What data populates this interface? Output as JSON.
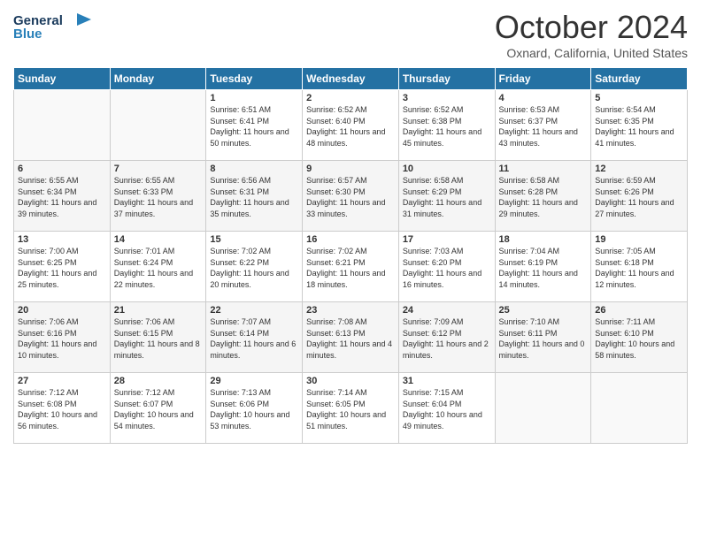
{
  "header": {
    "logo_line1": "General",
    "logo_line2": "Blue",
    "month": "October 2024",
    "location": "Oxnard, California, United States"
  },
  "days_of_week": [
    "Sunday",
    "Monday",
    "Tuesday",
    "Wednesday",
    "Thursday",
    "Friday",
    "Saturday"
  ],
  "weeks": [
    [
      {
        "day": "",
        "info": ""
      },
      {
        "day": "",
        "info": ""
      },
      {
        "day": "1",
        "info": "Sunrise: 6:51 AM\nSunset: 6:41 PM\nDaylight: 11 hours and 50 minutes."
      },
      {
        "day": "2",
        "info": "Sunrise: 6:52 AM\nSunset: 6:40 PM\nDaylight: 11 hours and 48 minutes."
      },
      {
        "day": "3",
        "info": "Sunrise: 6:52 AM\nSunset: 6:38 PM\nDaylight: 11 hours and 45 minutes."
      },
      {
        "day": "4",
        "info": "Sunrise: 6:53 AM\nSunset: 6:37 PM\nDaylight: 11 hours and 43 minutes."
      },
      {
        "day": "5",
        "info": "Sunrise: 6:54 AM\nSunset: 6:35 PM\nDaylight: 11 hours and 41 minutes."
      }
    ],
    [
      {
        "day": "6",
        "info": "Sunrise: 6:55 AM\nSunset: 6:34 PM\nDaylight: 11 hours and 39 minutes."
      },
      {
        "day": "7",
        "info": "Sunrise: 6:55 AM\nSunset: 6:33 PM\nDaylight: 11 hours and 37 minutes."
      },
      {
        "day": "8",
        "info": "Sunrise: 6:56 AM\nSunset: 6:31 PM\nDaylight: 11 hours and 35 minutes."
      },
      {
        "day": "9",
        "info": "Sunrise: 6:57 AM\nSunset: 6:30 PM\nDaylight: 11 hours and 33 minutes."
      },
      {
        "day": "10",
        "info": "Sunrise: 6:58 AM\nSunset: 6:29 PM\nDaylight: 11 hours and 31 minutes."
      },
      {
        "day": "11",
        "info": "Sunrise: 6:58 AM\nSunset: 6:28 PM\nDaylight: 11 hours and 29 minutes."
      },
      {
        "day": "12",
        "info": "Sunrise: 6:59 AM\nSunset: 6:26 PM\nDaylight: 11 hours and 27 minutes."
      }
    ],
    [
      {
        "day": "13",
        "info": "Sunrise: 7:00 AM\nSunset: 6:25 PM\nDaylight: 11 hours and 25 minutes."
      },
      {
        "day": "14",
        "info": "Sunrise: 7:01 AM\nSunset: 6:24 PM\nDaylight: 11 hours and 22 minutes."
      },
      {
        "day": "15",
        "info": "Sunrise: 7:02 AM\nSunset: 6:22 PM\nDaylight: 11 hours and 20 minutes."
      },
      {
        "day": "16",
        "info": "Sunrise: 7:02 AM\nSunset: 6:21 PM\nDaylight: 11 hours and 18 minutes."
      },
      {
        "day": "17",
        "info": "Sunrise: 7:03 AM\nSunset: 6:20 PM\nDaylight: 11 hours and 16 minutes."
      },
      {
        "day": "18",
        "info": "Sunrise: 7:04 AM\nSunset: 6:19 PM\nDaylight: 11 hours and 14 minutes."
      },
      {
        "day": "19",
        "info": "Sunrise: 7:05 AM\nSunset: 6:18 PM\nDaylight: 11 hours and 12 minutes."
      }
    ],
    [
      {
        "day": "20",
        "info": "Sunrise: 7:06 AM\nSunset: 6:16 PM\nDaylight: 11 hours and 10 minutes."
      },
      {
        "day": "21",
        "info": "Sunrise: 7:06 AM\nSunset: 6:15 PM\nDaylight: 11 hours and 8 minutes."
      },
      {
        "day": "22",
        "info": "Sunrise: 7:07 AM\nSunset: 6:14 PM\nDaylight: 11 hours and 6 minutes."
      },
      {
        "day": "23",
        "info": "Sunrise: 7:08 AM\nSunset: 6:13 PM\nDaylight: 11 hours and 4 minutes."
      },
      {
        "day": "24",
        "info": "Sunrise: 7:09 AM\nSunset: 6:12 PM\nDaylight: 11 hours and 2 minutes."
      },
      {
        "day": "25",
        "info": "Sunrise: 7:10 AM\nSunset: 6:11 PM\nDaylight: 11 hours and 0 minutes."
      },
      {
        "day": "26",
        "info": "Sunrise: 7:11 AM\nSunset: 6:10 PM\nDaylight: 10 hours and 58 minutes."
      }
    ],
    [
      {
        "day": "27",
        "info": "Sunrise: 7:12 AM\nSunset: 6:08 PM\nDaylight: 10 hours and 56 minutes."
      },
      {
        "day": "28",
        "info": "Sunrise: 7:12 AM\nSunset: 6:07 PM\nDaylight: 10 hours and 54 minutes."
      },
      {
        "day": "29",
        "info": "Sunrise: 7:13 AM\nSunset: 6:06 PM\nDaylight: 10 hours and 53 minutes."
      },
      {
        "day": "30",
        "info": "Sunrise: 7:14 AM\nSunset: 6:05 PM\nDaylight: 10 hours and 51 minutes."
      },
      {
        "day": "31",
        "info": "Sunrise: 7:15 AM\nSunset: 6:04 PM\nDaylight: 10 hours and 49 minutes."
      },
      {
        "day": "",
        "info": ""
      },
      {
        "day": "",
        "info": ""
      }
    ]
  ]
}
